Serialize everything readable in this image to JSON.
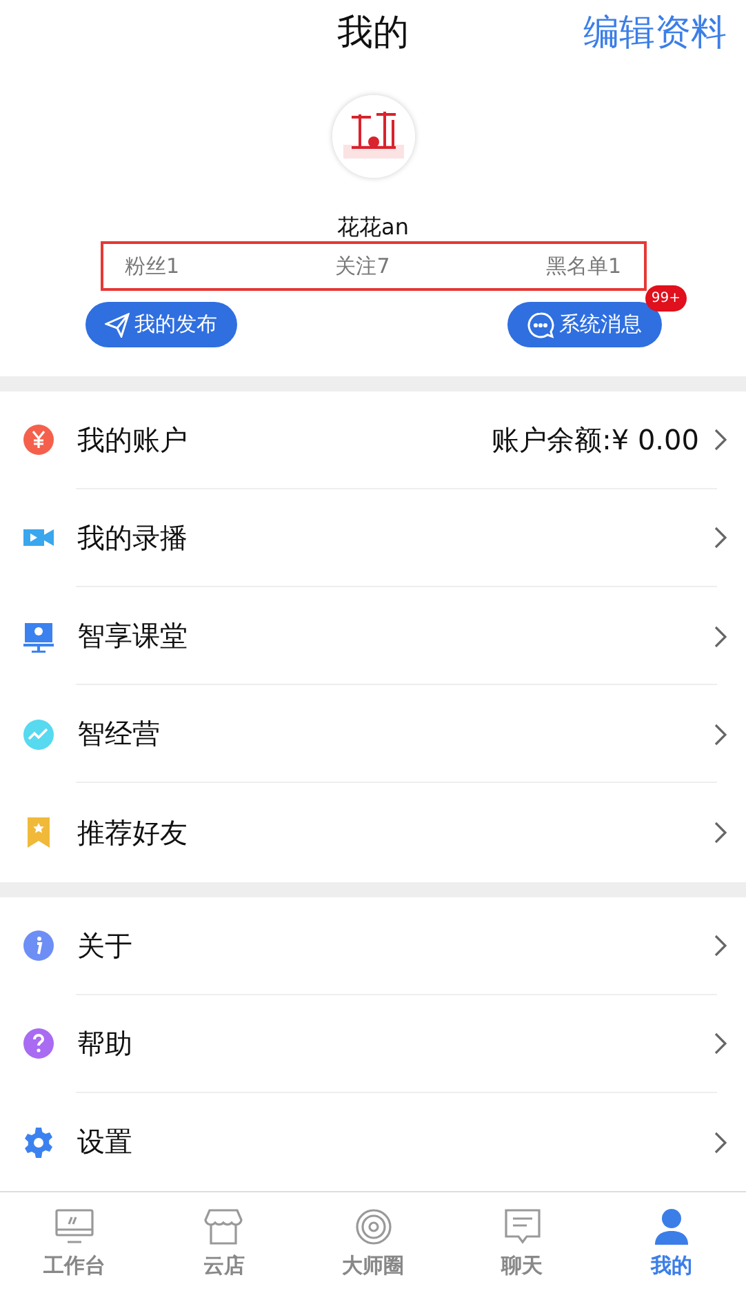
{
  "header": {
    "title": "我的",
    "action": "编辑资料"
  },
  "profile": {
    "name": "花花an",
    "stats": [
      "粉丝1",
      "关注7",
      "黑名单1"
    ],
    "buttons": [
      {
        "kind": "publish",
        "label": "我的发布"
      },
      {
        "kind": "messages",
        "label": "系统消息",
        "badge": "99+"
      }
    ]
  },
  "menu_groups": [
    [
      {
        "kind": "yuan",
        "color": "#f5604c",
        "label": "我的账户",
        "value": "账户余额:¥ 0.00"
      },
      {
        "kind": "video",
        "color": "#3aa6ee",
        "label": "我的录播"
      },
      {
        "kind": "screen",
        "color": "#3b82f0",
        "label": "智享课堂"
      },
      {
        "kind": "chart",
        "color": "#57d9ef",
        "label": "智经营"
      },
      {
        "kind": "bookmark",
        "color": "#f0b93a",
        "label": "推荐好友"
      }
    ],
    [
      {
        "kind": "info",
        "color": "#6d8ef5",
        "label": "关于"
      },
      {
        "kind": "help",
        "color": "#a86bf2",
        "label": "帮助"
      },
      {
        "kind": "gear",
        "color": "#3b82f0",
        "label": "设置"
      }
    ]
  ],
  "tab_bar": [
    {
      "kind": "monitor",
      "label": "工作台",
      "selected": false
    },
    {
      "kind": "store",
      "label": "云店",
      "selected": false
    },
    {
      "kind": "circle",
      "label": "大师圈",
      "selected": false
    },
    {
      "kind": "chat",
      "label": "聊天",
      "selected": false
    },
    {
      "kind": "person",
      "label": "我的",
      "selected": true
    }
  ]
}
